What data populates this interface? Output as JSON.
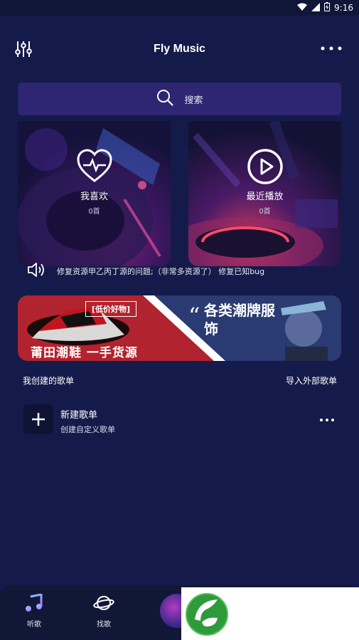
{
  "status_bar": {
    "time": "9:16"
  },
  "header": {
    "title": "Fly Music"
  },
  "search": {
    "label": "搜索"
  },
  "cards": [
    {
      "title": "我喜欢",
      "count": "0首"
    },
    {
      "title": "最近播放",
      "count": "0首"
    }
  ],
  "notice": {
    "text": "修复资源甲乙丙丁源的问题;（非常多资源了） 修复已知bug"
  },
  "banner": {
    "tag": "[低价好物]",
    "headline": "莆田潮鞋 一手货源",
    "title": "各类潮牌服饰"
  },
  "section": {
    "left": "我创建的歌单",
    "right": "导入外部歌单"
  },
  "playlist": {
    "name": "新建歌单",
    "sub": "创建自定义歌单"
  },
  "nav": [
    {
      "label": "听歌"
    },
    {
      "label": "找歌"
    }
  ],
  "colors": {
    "background": "#141b4a",
    "search": "#2e2672",
    "banner_red": "#b1232e",
    "banner_blue": "#2a3a72"
  }
}
